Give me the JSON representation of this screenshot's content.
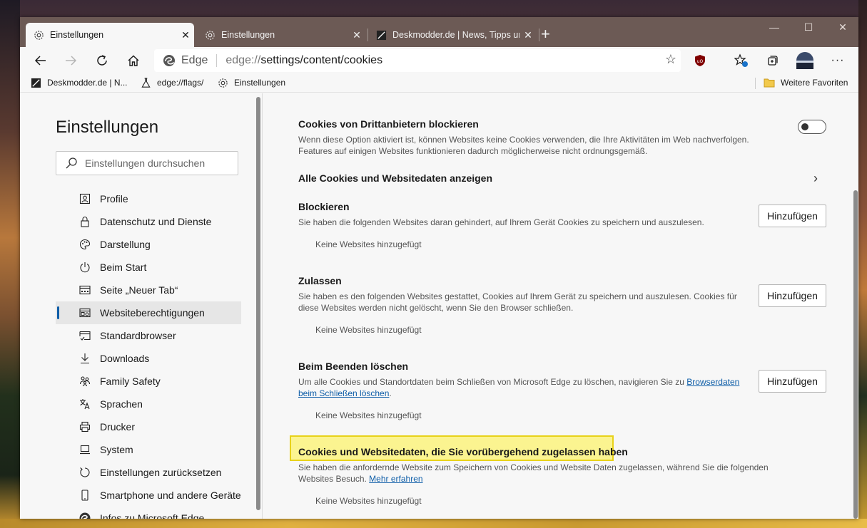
{
  "tabs": [
    {
      "label": "Einstellungen",
      "close": "✕"
    },
    {
      "label": "Einstellungen",
      "close": "✕"
    },
    {
      "label": "Deskmodder.de | News, Tipps un",
      "close": "✕"
    }
  ],
  "new_tab": "+",
  "window_controls": {
    "minimize": "—",
    "maximize": "☐",
    "close": "✕"
  },
  "address": {
    "brand": "Edge",
    "url_host": "edge://",
    "url_path": "settings/content/cookies"
  },
  "favorites": [
    {
      "label": "Deskmodder.de | N..."
    },
    {
      "label": "edge://flags/"
    },
    {
      "label": "Einstellungen"
    }
  ],
  "other_favorites": "Weitere Favoriten",
  "sidebar": {
    "title": "Einstellungen",
    "search_placeholder": "Einstellungen durchsuchen",
    "items": [
      {
        "label": "Profile",
        "icon": "profile-icon"
      },
      {
        "label": "Datenschutz und Dienste",
        "icon": "lock-icon"
      },
      {
        "label": "Darstellung",
        "icon": "palette-icon"
      },
      {
        "label": "Beim Start",
        "icon": "power-icon"
      },
      {
        "label": "Seite „Neuer Tab“",
        "icon": "newtab-page-icon"
      },
      {
        "label": "Websiteberechtigungen",
        "icon": "site-permissions-icon",
        "selected": true
      },
      {
        "label": "Standardbrowser",
        "icon": "default-browser-icon"
      },
      {
        "label": "Downloads",
        "icon": "download-icon"
      },
      {
        "label": "Family Safety",
        "icon": "family-icon"
      },
      {
        "label": "Sprachen",
        "icon": "language-icon"
      },
      {
        "label": "Drucker",
        "icon": "printer-icon"
      },
      {
        "label": "System",
        "icon": "system-icon"
      },
      {
        "label": "Einstellungen zurücksetzen",
        "icon": "reset-icon"
      },
      {
        "label": "Smartphone und andere Geräte",
        "icon": "phone-icon"
      },
      {
        "label": "Infos zu Microsoft Edge",
        "icon": "edge-logo-icon"
      }
    ]
  },
  "main": {
    "third_party": {
      "title": "Cookies von Drittanbietern blockieren",
      "desc": "Wenn diese Option aktiviert ist, können Websites keine Cookies verwenden, die Ihre Aktivitäten im Web nachverfolgen. Features auf einigen Websites funktionieren dadurch möglicherweise nicht ordnungsgemäß.",
      "toggle_on": false
    },
    "all_cookies": {
      "title": "Alle Cookies und Websitedaten anzeigen"
    },
    "block": {
      "title": "Blockieren",
      "desc": "Sie haben die folgenden Websites daran gehindert, auf Ihrem Gerät Cookies zu speichern und auszulesen.",
      "empty": "Keine Websites hinzugefügt",
      "button": "Hinzufügen"
    },
    "allow": {
      "title": "Zulassen",
      "desc": "Sie haben es den folgenden Websites gestattet, Cookies auf Ihrem Gerät zu speichern und auszulesen. Cookies für diese Websites werden nicht gelöscht, wenn Sie den Browser schließen.",
      "empty": "Keine Websites hinzugefügt",
      "button": "Hinzufügen"
    },
    "clear_on_exit": {
      "title": "Beim Beenden löschen",
      "desc_prefix": "Um alle Cookies und Standortdaten beim Schließen von Microsoft Edge zu löschen, navigieren Sie zu ",
      "link": "Browserdaten beim Schließen löschen",
      "desc_suffix": ".",
      "empty": "Keine Websites hinzugefügt",
      "button": "Hinzufügen"
    },
    "temporary": {
      "title": "Cookies und Websitedaten, die Sie vorübergehend zugelassen haben",
      "desc_prefix": "Sie haben die anfordernde Website zum Speichern von Cookies und Website Daten zugelassen, während Sie die folgenden Websites Besuch. ",
      "link": "Mehr erfahren",
      "empty": "Keine Websites hinzugefügt"
    }
  }
}
